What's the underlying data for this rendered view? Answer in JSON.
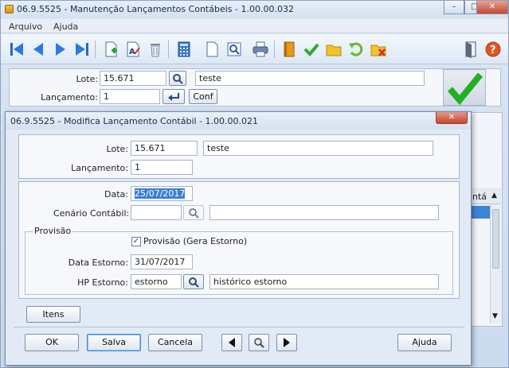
{
  "main": {
    "title": "06.9.5525 - Manutenção Lançamentos Contábeis - 1.00.00.032",
    "menu": [
      "Arquivo",
      "Ajuda"
    ],
    "lote_label": "Lote:",
    "lote_value": "15.671",
    "lote_desc": "teste",
    "lancamento_label": "Lançamento:",
    "lancamento_value": "1",
    "conf_label": "Conf"
  },
  "window_buttons": {
    "minimize": "–",
    "maximize": "□",
    "close": "✕"
  },
  "toolbar_icons": [
    "first-icon",
    "previous-icon",
    "next-icon",
    "last-icon",
    "new-document-icon",
    "edit-text-icon",
    "delete-icon",
    "calculator-icon",
    "blank-page-icon",
    "zoom-page-icon",
    "print-icon",
    "book-icon",
    "confirm-check-icon",
    "folder-icon",
    "undo-icon",
    "cancel-folder-icon",
    "exit-door-icon",
    "help-icon"
  ],
  "background_table": {
    "header_fragment": "ntá"
  },
  "dialog": {
    "title": "06.9.5525 - Modifica Lançamento Contábil - 1.00.00.021",
    "close": "✕",
    "lote_label": "Lote:",
    "lote_value": "15.671",
    "lote_desc": "teste",
    "lancamento_label": "Lançamento:",
    "lancamento_value": "1",
    "data_label": "Data:",
    "data_value": "25/07/2017",
    "cenario_label": "Cenário Contábil:",
    "cenario_value": "",
    "cenario_desc": "",
    "provisao_group": "Provisão",
    "provisao_check_label": "Provisão (Gera Estorno)",
    "provisao_checked": true,
    "data_estorno_label": "Data Estorno:",
    "data_estorno_value": "31/07/2017",
    "hp_estorno_label": "HP Estorno:",
    "hp_estorno_value": "estorno",
    "hp_estorno_desc": "histórico estorno",
    "itens_label": "Itens",
    "ok_label": "OK",
    "salva_label": "Salva",
    "cancela_label": "Cancela",
    "ajuda_label": "Ajuda"
  }
}
